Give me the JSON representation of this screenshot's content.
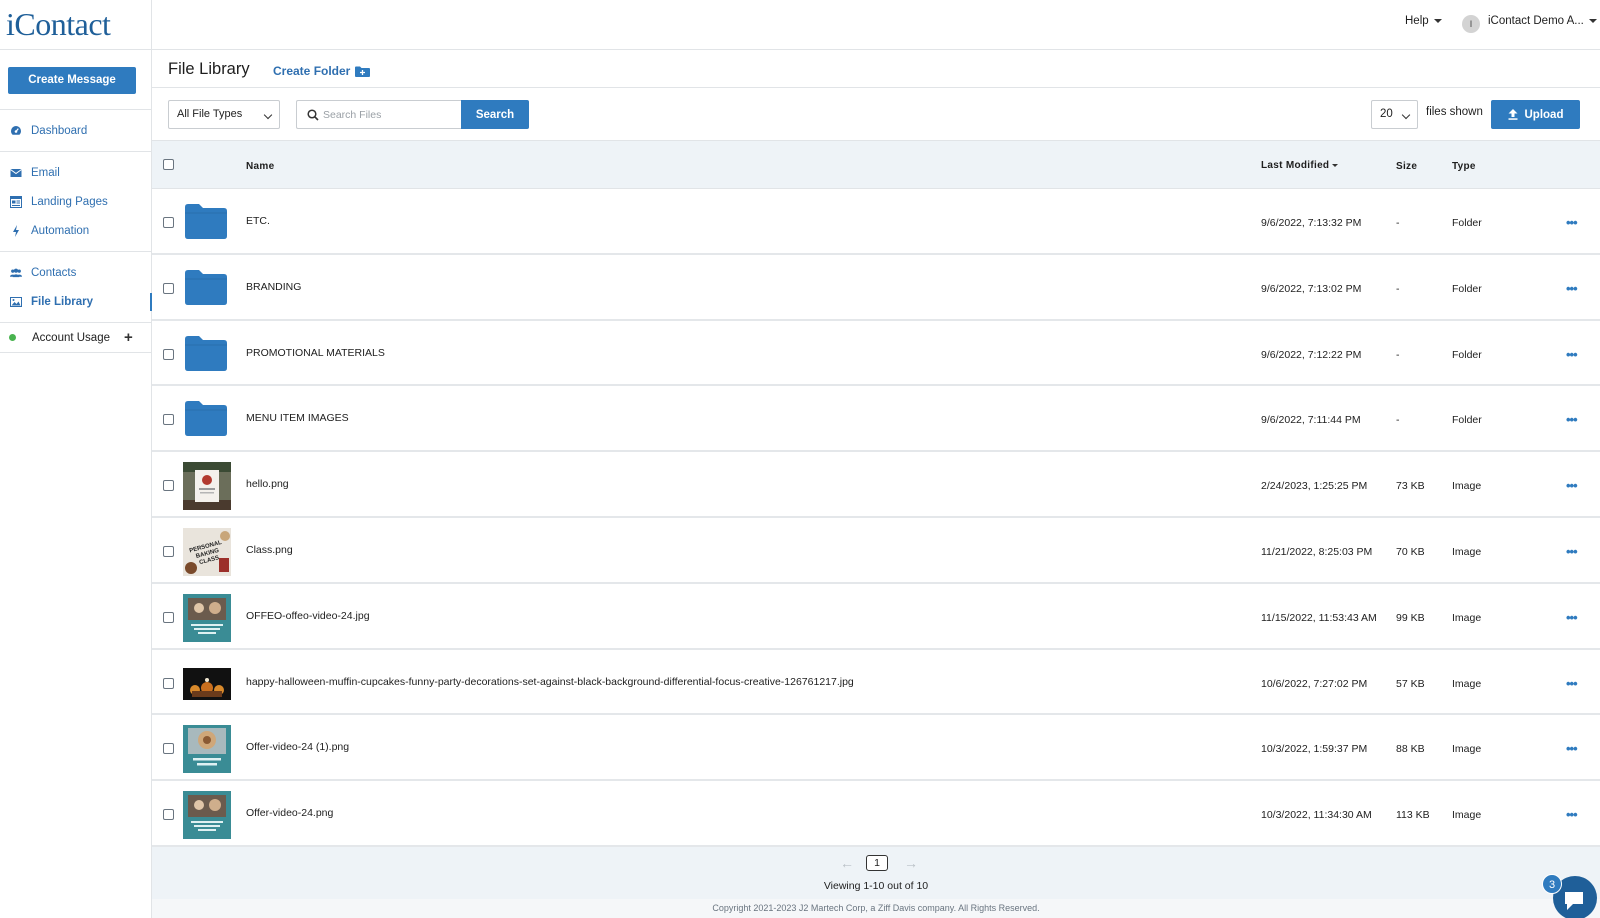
{
  "brand": {
    "logo_text": "iContact"
  },
  "sidebar": {
    "create_label": "Create Message",
    "items": [
      {
        "label": "Dashboard",
        "icon": "dashboard-icon"
      },
      {
        "label": "Email",
        "icon": "envelope-icon"
      },
      {
        "label": "Landing Pages",
        "icon": "landing-page-icon"
      },
      {
        "label": "Automation",
        "icon": "lightning-icon"
      },
      {
        "label": "Contacts",
        "icon": "users-icon"
      },
      {
        "label": "File Library",
        "icon": "image-icon",
        "active": true
      }
    ],
    "usage_label": "Account Usage"
  },
  "topbar": {
    "help_label": "Help",
    "avatar_initial": "I",
    "user_name": "iContact Demo A..."
  },
  "header": {
    "title": "File Library",
    "create_folder_label": "Create Folder"
  },
  "toolbar": {
    "type_filter": "All File Types",
    "search_placeholder": "Search Files",
    "search_label": "Search",
    "per_page": "20",
    "files_shown_label": "files shown",
    "upload_label": "Upload"
  },
  "table": {
    "columns": {
      "name": "Name",
      "modified": "Last Modified",
      "size": "Size",
      "type": "Type"
    },
    "rows": [
      {
        "name": "ETC.",
        "modified": "9/6/2022, 7:13:32 PM",
        "size": "-",
        "type": "Folder",
        "kind": "folder"
      },
      {
        "name": "BRANDING",
        "modified": "9/6/2022, 7:13:02 PM",
        "size": "-",
        "type": "Folder",
        "kind": "folder"
      },
      {
        "name": "PROMOTIONAL MATERIALS",
        "modified": "9/6/2022, 7:12:22 PM",
        "size": "-",
        "type": "Folder",
        "kind": "folder"
      },
      {
        "name": "MENU ITEM IMAGES",
        "modified": "9/6/2022, 7:11:44 PM",
        "size": "-",
        "type": "Folder",
        "kind": "folder"
      },
      {
        "name": "hello.png",
        "modified": "2/24/2023, 1:25:25 PM",
        "size": "73 KB",
        "type": "Image",
        "kind": "image",
        "thumb": "hello"
      },
      {
        "name": "Class.png",
        "modified": "11/21/2022, 8:25:03 PM",
        "size": "70 KB",
        "type": "Image",
        "kind": "image",
        "thumb": "class"
      },
      {
        "name": "OFFEO-offeo-video-24.jpg",
        "modified": "11/15/2022, 11:53:43 AM",
        "size": "99 KB",
        "type": "Image",
        "kind": "image",
        "thumb": "teal"
      },
      {
        "name": "happy-halloween-muffin-cupcakes-funny-party-decorations-set-against-black-background-differential-focus-creative-126761217.jpg",
        "modified": "10/6/2022, 7:27:02 PM",
        "size": "57 KB",
        "type": "Image",
        "kind": "image",
        "thumb": "dark"
      },
      {
        "name": "Offer-video-24 (1).png",
        "modified": "10/3/2022, 1:59:37 PM",
        "size": "88 KB",
        "type": "Image",
        "kind": "image",
        "thumb": "teal2"
      },
      {
        "name": "Offer-video-24.png",
        "modified": "10/3/2022, 11:34:30 AM",
        "size": "113 KB",
        "type": "Image",
        "kind": "image",
        "thumb": "teal"
      }
    ]
  },
  "pager": {
    "current_page": "1",
    "viewing_text": "Viewing 1-10 out of 10"
  },
  "footer": {
    "copyright": "Copyright 2021-2023 J2 Martech Corp, a Ziff Davis company. All Rights Reserved."
  },
  "chat": {
    "badge_count": "3"
  },
  "colors": {
    "accent": "#2f7bbf",
    "brand": "#1f5f99",
    "folder": "#2f7bbf",
    "usage_dot": "#49b34f"
  }
}
